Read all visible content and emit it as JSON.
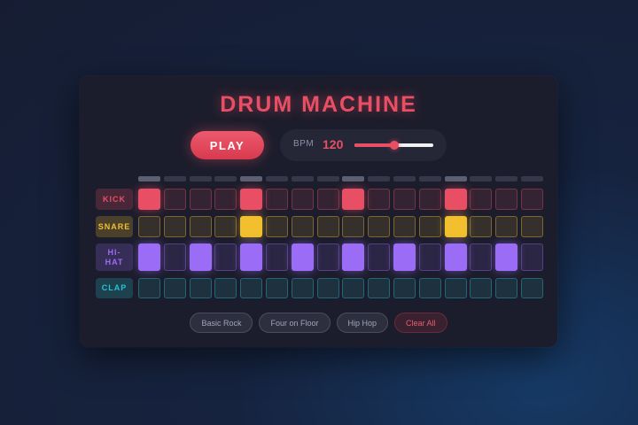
{
  "title": "DRUM MACHINE",
  "transport": {
    "play_label": "PLAY",
    "bpm_label": "BPM",
    "bpm_value": "120",
    "bpm_slider_fraction": 0.5
  },
  "steps": 16,
  "tracks": [
    {
      "label": "KICK",
      "accent": "#e94f64",
      "pattern": [
        1,
        0,
        0,
        0,
        1,
        0,
        0,
        0,
        1,
        0,
        0,
        0,
        1,
        0,
        0,
        0
      ]
    },
    {
      "label": "SNARE",
      "accent": "#f2bf2e",
      "pattern": [
        0,
        0,
        0,
        0,
        1,
        0,
        0,
        0,
        0,
        0,
        0,
        0,
        1,
        0,
        0,
        0
      ]
    },
    {
      "label": "HI-\nHAT",
      "accent": "#9b6cf5",
      "pattern": [
        1,
        0,
        1,
        0,
        1,
        0,
        1,
        0,
        1,
        0,
        1,
        0,
        1,
        0,
        1,
        0
      ]
    },
    {
      "label": "CLAP",
      "accent": "#27c2cf",
      "pattern": [
        0,
        0,
        0,
        0,
        0,
        0,
        0,
        0,
        0,
        0,
        0,
        0,
        0,
        0,
        0,
        0
      ]
    }
  ],
  "presets": [
    {
      "label": "Basic Rock",
      "style": "normal"
    },
    {
      "label": "Four on Floor",
      "style": "normal"
    },
    {
      "label": "Hip Hop",
      "style": "normal"
    },
    {
      "label": "Clear All",
      "style": "danger"
    }
  ]
}
